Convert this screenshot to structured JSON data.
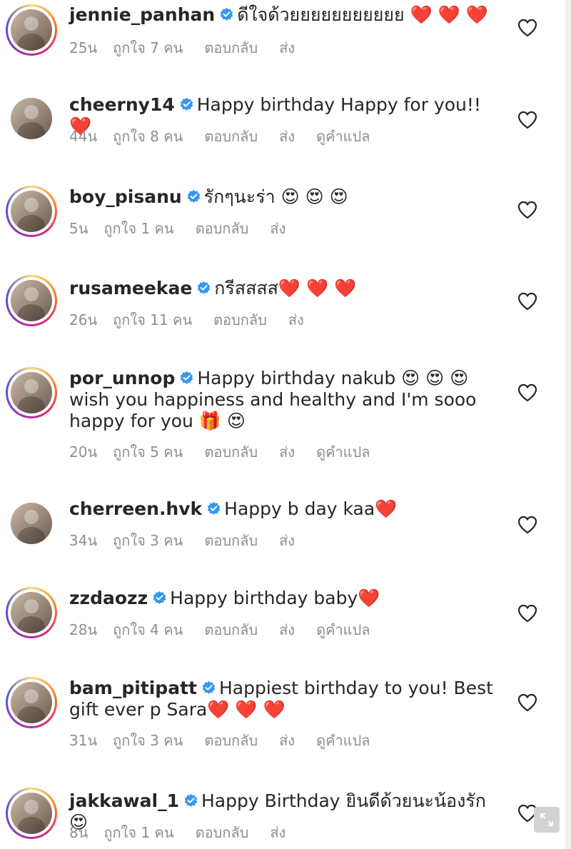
{
  "meta_labels": {
    "reply": "ตอบกลับ",
    "send": "ส่ง",
    "translate": "ดูคำแปล"
  },
  "icons": {
    "verified": "verified-badge-icon",
    "like": "heart-outline-icon",
    "expand": "expand-arrows-icon"
  },
  "colors": {
    "verified": "#3897f0",
    "meta_text": "#8e8e8e",
    "heart_emoji": "#e0142b"
  },
  "comments": [
    {
      "username": "jennie_panhan",
      "text": "ดีใจด้วยยยยยยยยยยย ❤️ ❤️ ❤️",
      "time": "25น",
      "likes": "ถูกใจ 7 คน",
      "show_translate": false,
      "story_ring": true
    },
    {
      "username": "cheerny14",
      "text": "Happy birthday Happy for you!!❤️",
      "time": "44น",
      "likes": "ถูกใจ 8 คน",
      "show_translate": true,
      "story_ring": false
    },
    {
      "username": "boy_pisanu",
      "text": "รักๆนะร่า 😍 😍 😍",
      "time": "5น",
      "likes": "ถูกใจ 1 คน",
      "show_translate": false,
      "story_ring": true
    },
    {
      "username": "rusameekae",
      "text": "กรีสสสส❤️ ❤️ ❤️",
      "time": "26น",
      "likes": "ถูกใจ 11 คน",
      "show_translate": false,
      "story_ring": true
    },
    {
      "username": "por_unnop",
      "text": "Happy birthday nakub 😍 😍 😍 wish you happiness and healthy and I'm sooo happy for you 🎁 😍",
      "time": "20น",
      "likes": "ถูกใจ 5 คน",
      "show_translate": true,
      "story_ring": true
    },
    {
      "username": "cherreen.hvk",
      "text": "Happy b day kaa❤️",
      "time": "34น",
      "likes": "ถูกใจ 3 คน",
      "show_translate": false,
      "story_ring": false
    },
    {
      "username": "zzdaozz",
      "text": "Happy birthday baby❤️",
      "time": "28น",
      "likes": "ถูกใจ 4 คน",
      "show_translate": true,
      "story_ring": true
    },
    {
      "username": "bam_pitipatt",
      "text": "Happiest birthday to you! Best gift ever p Sara❤️ ❤️ ❤️",
      "time": "31น",
      "likes": "ถูกใจ 3 คน",
      "show_translate": true,
      "story_ring": true
    },
    {
      "username": "jakkawal_1",
      "text": "Happy Birthday ยินดีด้วยนะน้องรัก😍",
      "time": "8น",
      "likes": "ถูกใจ 1 คน",
      "show_translate": false,
      "story_ring": true
    }
  ]
}
